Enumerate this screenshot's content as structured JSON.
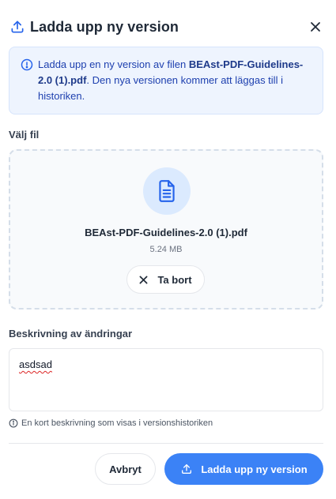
{
  "dialog": {
    "title": "Ladda upp ny version",
    "close_icon": "close-icon",
    "title_icon": "upload-icon"
  },
  "info": {
    "icon": "info-icon",
    "text_before": "Ladda upp en ny version av filen ",
    "filename": "BEAst-PDF-Guidelines-2.0 (1).pdf",
    "text_after": ". Den nya versionen kommer att läggas till i historiken."
  },
  "file_section": {
    "label": "Välj fil",
    "file_icon": "document-icon",
    "file_name": "BEAst-PDF-Guidelines-2.0 (1).pdf",
    "file_size": "5.24 MB",
    "remove_label": "Ta bort",
    "remove_icon": "close-icon"
  },
  "description": {
    "label": "Beskrivning av ändringar",
    "value": "asdsad",
    "hint": "En kort beskrivning som visas i versionshistoriken",
    "hint_icon": "info-icon"
  },
  "footer": {
    "cancel_label": "Avbryt",
    "submit_label": "Ladda upp ny version",
    "submit_icon": "upload-icon"
  },
  "colors": {
    "accent": "#3b82f6",
    "info_bg": "#eef4fe",
    "info_text": "#1e40af"
  }
}
